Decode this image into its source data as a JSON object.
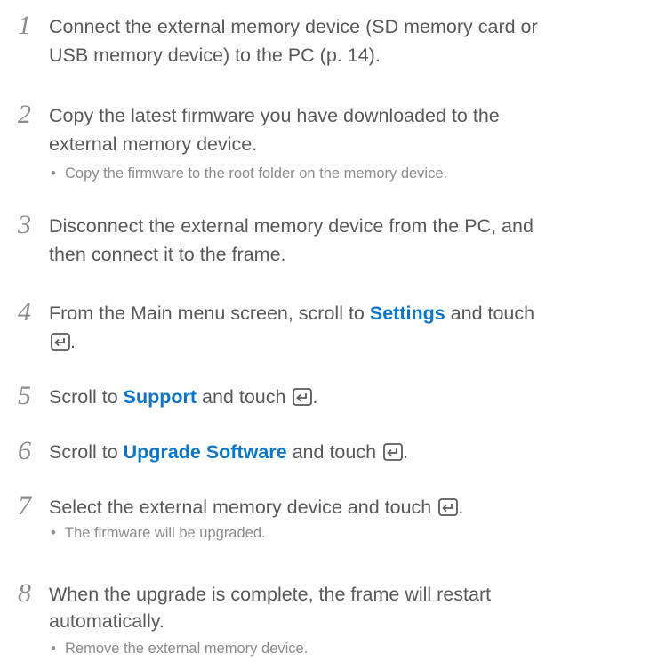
{
  "steps": [
    {
      "number": "1",
      "line1": "Connect the external memory device (SD memory card or",
      "line2": "USB memory device) to the PC (p. 14)."
    },
    {
      "number": "2",
      "line1": "Copy the latest firmware you have downloaded to the",
      "line2": "external memory device.",
      "note": "Copy the firmware to the root folder on the memory device."
    },
    {
      "number": "3",
      "line1": "Disconnect the external memory device from the PC, and",
      "line2": "then connect it to the frame."
    },
    {
      "number": "4",
      "pre": "From the Main menu screen, scroll to ",
      "highlight": "Settings",
      "post": " and touch",
      "end": "."
    },
    {
      "number": "5",
      "pre": "Scroll to ",
      "highlight": "Support",
      "post": " and touch ",
      "end": "."
    },
    {
      "number": "6",
      "pre": "Scroll to ",
      "highlight": "Upgrade Software",
      "post": " and touch ",
      "end": "."
    },
    {
      "number": "7",
      "pre": "Select the external memory device and touch ",
      "end": ".",
      "note": "The firmware will be upgraded."
    },
    {
      "number": "8",
      "line1": "When the upgrade is complete, the frame will restart",
      "line2": "automatically.",
      "note": "Remove the external memory device."
    }
  ],
  "bullet_char": "•",
  "colors": {
    "text": "#58595b",
    "muted": "#8a8c8e",
    "highlight": "#0a75c9"
  },
  "icons": {
    "enter": "enter-button-icon"
  }
}
